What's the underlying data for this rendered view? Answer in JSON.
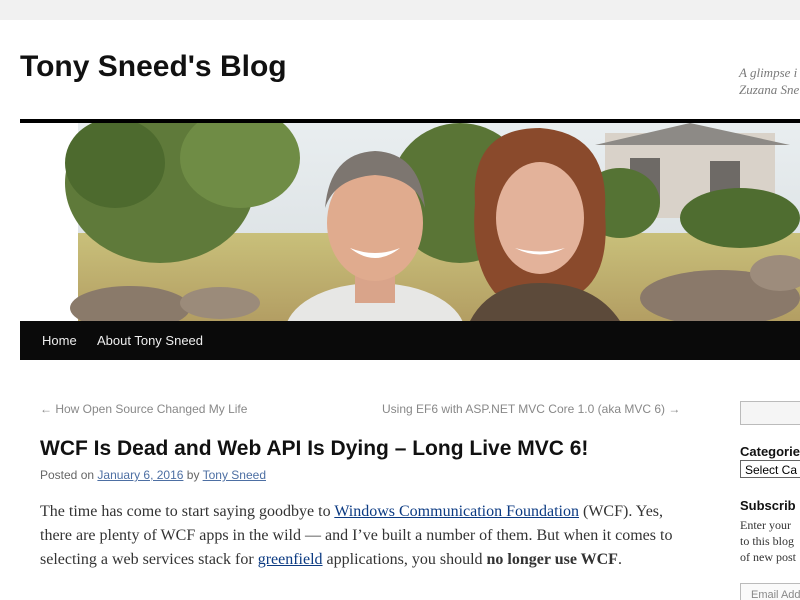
{
  "site": {
    "title": "Tony Sneed's Blog",
    "description_line1": "A glimpse i",
    "description_line2": "Zuzana Sne"
  },
  "nav": {
    "items": [
      {
        "label": "Home"
      },
      {
        "label": "About Tony Sneed"
      }
    ]
  },
  "post_nav": {
    "previous": "← How Open Source Changed My Life",
    "next": "Using EF6 with ASP.NET MVC Core 1.0 (aka MVC 6) →"
  },
  "post": {
    "title": "WCF Is Dead and Web API Is Dying – Long Live MVC 6!",
    "meta": {
      "posted_on": "Posted on",
      "date": "January 6, 2016",
      "by": "by",
      "author": "Tony Sneed"
    },
    "body": {
      "t1": "The time has come to start saying goodbye to ",
      "link1": "Windows Communication Foundation",
      "t2": " (WCF).  Yes, there are plenty of WCF apps in the wild — and I’ve built a number of them.  But when it comes to selecting a web services stack for ",
      "link2": "greenfield",
      "t3": " applications, you should ",
      "bold": "no longer use WCF",
      "t4": "."
    }
  },
  "sidebar": {
    "categories_heading": "Categorie",
    "categories_select": "Select Ca",
    "subscribe_heading": "Subscrib",
    "subscribe_line1": "Enter your",
    "subscribe_line2": "to this blog",
    "subscribe_line3": "of new post",
    "email_placeholder": "Email Add"
  },
  "colors": {
    "nav_background": "#0a0a0a",
    "link": "#0b3a82"
  }
}
